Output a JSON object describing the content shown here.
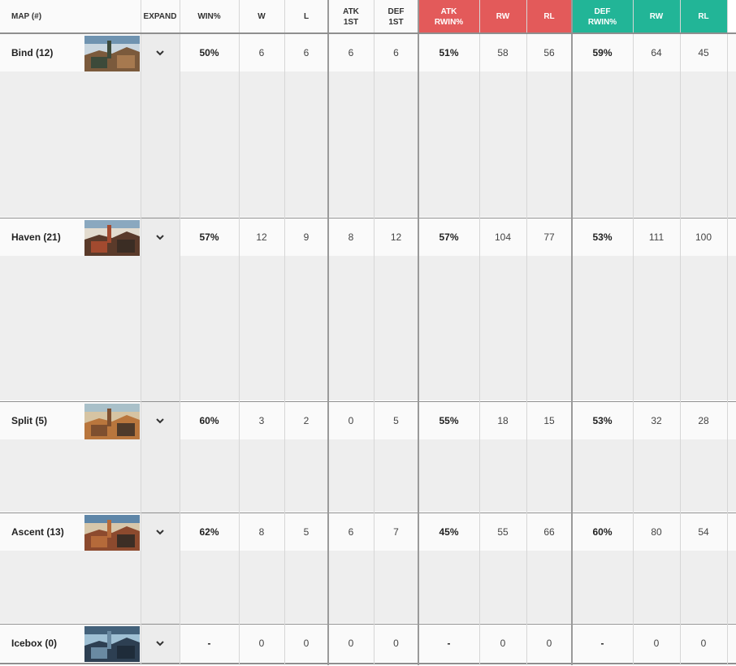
{
  "headers": {
    "map": "MAP (#)",
    "expand": "EXPAND",
    "winpct": "WIN%",
    "w": "W",
    "l": "L",
    "atk1st": "ATK\n1ST",
    "def1st": "DEF\n1ST",
    "atkrwin": "ATK\nRWIN%",
    "atkrw": "RW",
    "atkrl": "RL",
    "defrwin": "DEF\nRWIN%",
    "defrw": "RW",
    "defrl": "RL"
  },
  "colors": {
    "atk": "#e35a5a",
    "def": "#22b597"
  },
  "rows": [
    {
      "map": "Bind (12)",
      "expand_icon": "chevron-down-icon",
      "winpct": "50%",
      "w": "6",
      "l": "6",
      "atk1st": "6",
      "def1st": "6",
      "atkrwin": "51%",
      "atkrw": "58",
      "atkrl": "56",
      "defrwin": "59%",
      "defrw": "64",
      "defrl": "45"
    },
    {
      "map": "Haven (21)",
      "expand_icon": "chevron-down-icon",
      "winpct": "57%",
      "w": "12",
      "l": "9",
      "atk1st": "8",
      "def1st": "12",
      "atkrwin": "57%",
      "atkrw": "104",
      "atkrl": "77",
      "defrwin": "53%",
      "defrw": "111",
      "defrl": "100"
    },
    {
      "map": "Split (5)",
      "expand_icon": "chevron-down-icon",
      "winpct": "60%",
      "w": "3",
      "l": "2",
      "atk1st": "0",
      "def1st": "5",
      "atkrwin": "55%",
      "atkrw": "18",
      "atkrl": "15",
      "defrwin": "53%",
      "defrw": "32",
      "defrl": "28"
    },
    {
      "map": "Ascent (13)",
      "expand_icon": "chevron-down-icon",
      "winpct": "62%",
      "w": "8",
      "l": "5",
      "atk1st": "6",
      "def1st": "7",
      "atkrwin": "45%",
      "atkrw": "55",
      "atkrl": "66",
      "defrwin": "60%",
      "defrw": "80",
      "defrl": "54"
    },
    {
      "map": "Icebox (0)",
      "expand_icon": "chevron-down-icon",
      "winpct": "-",
      "w": "0",
      "l": "0",
      "atk1st": "0",
      "def1st": "0",
      "atkrwin": "-",
      "atkrw": "0",
      "atkrl": "0",
      "defrwin": "-",
      "defrw": "0",
      "defrl": "0"
    }
  ]
}
